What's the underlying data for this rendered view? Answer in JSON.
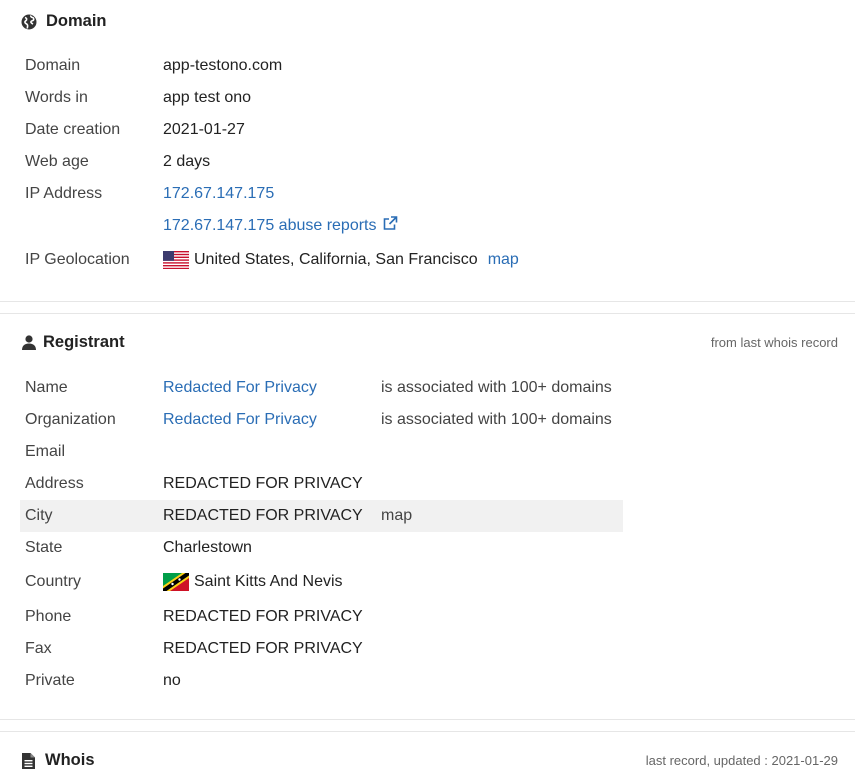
{
  "domain_section": {
    "title": "Domain",
    "rows": {
      "domain": {
        "label": "Domain",
        "value": "app-testono.com"
      },
      "words": {
        "label": "Words in",
        "value": "app test ono"
      },
      "date": {
        "label": "Date creation",
        "value": "2021-01-27"
      },
      "age": {
        "label": "Web age",
        "value": "2 days"
      },
      "ip": {
        "label": "IP Address",
        "value": "172.67.147.175"
      },
      "abuse": {
        "value": "172.67.147.175 abuse reports"
      },
      "geo": {
        "label": "IP Geolocation",
        "value": "United States, California, San Francisco",
        "map": "map"
      }
    }
  },
  "registrant_section": {
    "title": "Registrant",
    "note": "from last whois record",
    "rows": {
      "name": {
        "label": "Name",
        "value": "Redacted For Privacy",
        "extra": "is associated with 100+ domains"
      },
      "org": {
        "label": "Organization",
        "value": "Redacted For Privacy",
        "extra": "is associated with 100+ domains"
      },
      "email": {
        "label": "Email",
        "value": ""
      },
      "address": {
        "label": "Address",
        "value": "REDACTED FOR PRIVACY"
      },
      "city": {
        "label": "City",
        "value": "REDACTED FOR PRIVACY",
        "map": "map"
      },
      "state": {
        "label": "State",
        "value": "Charlestown"
      },
      "country": {
        "label": "Country",
        "value": "Saint Kitts And Nevis"
      },
      "phone": {
        "label": "Phone",
        "value": "REDACTED FOR PRIVACY"
      },
      "fax": {
        "label": "Fax",
        "value": "REDACTED FOR PRIVACY"
      },
      "private": {
        "label": "Private",
        "value": "no"
      }
    }
  },
  "whois_section": {
    "title": "Whois",
    "note": "last record, updated : 2021-01-29"
  },
  "colors": {
    "link": "#2a6db5",
    "highlight_row": "#f1f1f1"
  },
  "icons": [
    "globe-icon",
    "external-link-icon",
    "user-icon",
    "document-icon",
    "us-flag-icon",
    "kn-flag-icon"
  ]
}
